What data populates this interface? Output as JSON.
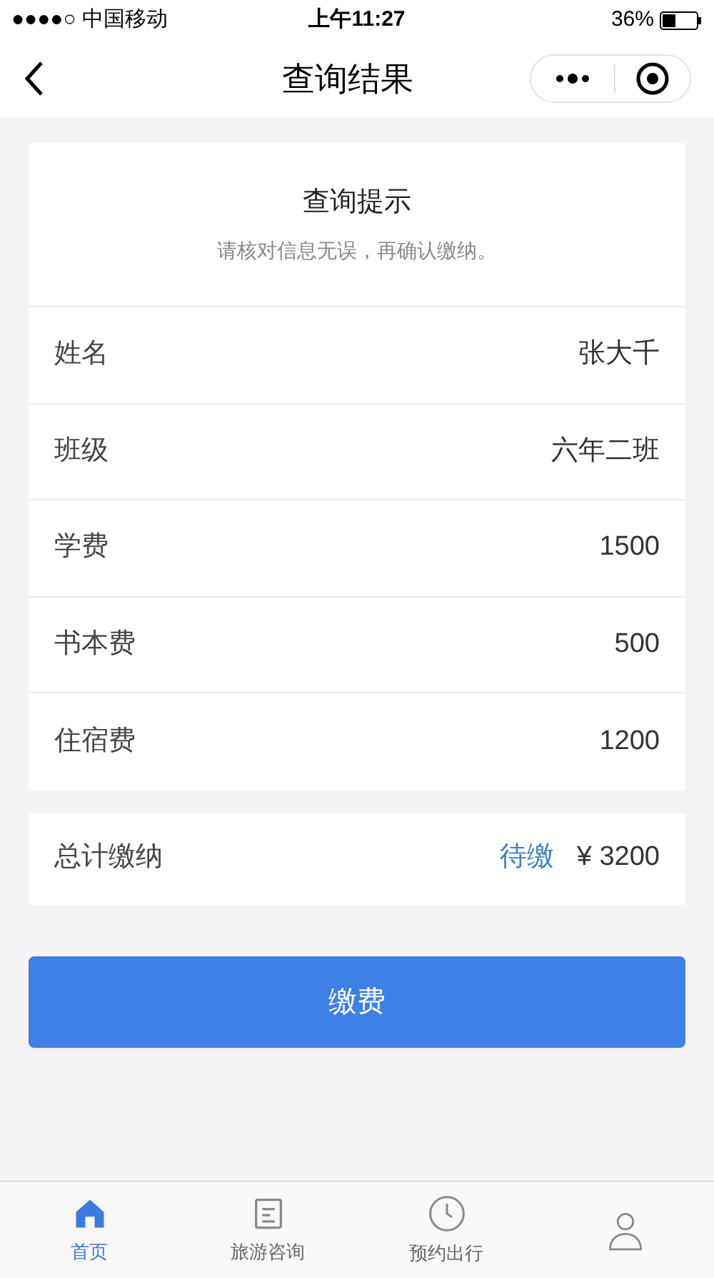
{
  "status_bar": {
    "carrier": "●●●●○ 中国移动",
    "time": "上午11:27",
    "battery": "36%"
  },
  "nav": {
    "title": "查询结果"
  },
  "notice": {
    "title": "查询提示",
    "subtitle": "请核对信息无误，再确认缴纳。"
  },
  "rows": [
    {
      "label": "姓名",
      "value": "张大千"
    },
    {
      "label": "班级",
      "value": "六年二班"
    },
    {
      "label": "学费",
      "value": "1500"
    },
    {
      "label": "书本费",
      "value": "500"
    },
    {
      "label": "住宿费",
      "value": "1200"
    }
  ],
  "total": {
    "label": "总计缴纳",
    "status": "待缴",
    "amount": "¥ 3200"
  },
  "pay_button": "缴费",
  "tab_bar": [
    {
      "kind": "home",
      "label": "首页",
      "selected": true
    },
    {
      "kind": "doc",
      "label": "旅游咨询",
      "selected": false
    },
    {
      "kind": "clock",
      "label": "预约出行",
      "selected": false
    },
    {
      "kind": "user",
      "selected": false
    }
  ]
}
